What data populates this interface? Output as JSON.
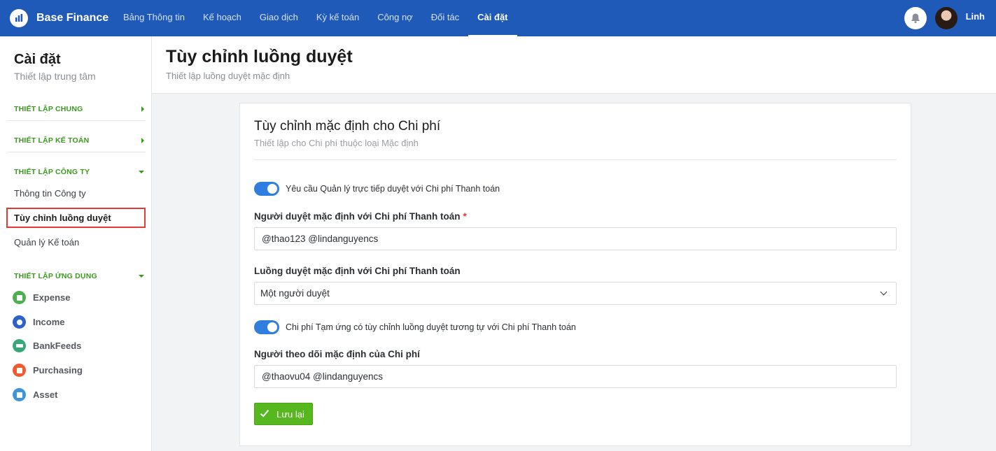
{
  "app": {
    "name": "Base Finance"
  },
  "nav": {
    "items": [
      {
        "label": "Bảng Thông tin"
      },
      {
        "label": "Kế hoạch"
      },
      {
        "label": "Giao dịch"
      },
      {
        "label": "Kỳ kế toán"
      },
      {
        "label": "Công nợ"
      },
      {
        "label": "Đối tác"
      },
      {
        "label": "Cài đặt",
        "active": true
      }
    ]
  },
  "user": {
    "name": "Linh"
  },
  "sidebar": {
    "title": "Cài đặt",
    "subtitle": "Thiết lập trung tâm",
    "sections": [
      {
        "label": "THIẾT LẬP CHUNG",
        "expanded": false
      },
      {
        "label": "THIẾT LẬP KẾ TOÁN",
        "expanded": false
      },
      {
        "label": "THIẾT LẬP CÔNG TY",
        "expanded": true
      },
      {
        "label": "THIẾT LẬP ỨNG DỤNG",
        "expanded": true
      }
    ],
    "company_links": [
      {
        "label": "Thông tin Công ty"
      },
      {
        "label": "Tùy chỉnh luồng duyệt",
        "active": true
      },
      {
        "label": "Quản lý Kế toán"
      }
    ],
    "apps": [
      {
        "label": "Expense",
        "icon": "expense-icon",
        "color": "#4caf50"
      },
      {
        "label": "Income",
        "icon": "income-icon",
        "color": "#2f5fc9"
      },
      {
        "label": "BankFeeds",
        "icon": "bankfeeds-icon",
        "color": "#3aa77a"
      },
      {
        "label": "Purchasing",
        "icon": "purchasing-icon",
        "color": "#ef5a2f"
      },
      {
        "label": "Asset",
        "icon": "asset-icon",
        "color": "#3f95d8"
      }
    ]
  },
  "page": {
    "title": "Tùy chỉnh luồng duyệt",
    "subtitle": "Thiết lập luồng duyệt mặc định"
  },
  "card": {
    "title": "Tùy chỉnh mặc định cho Chi phí",
    "subtitle": "Thiết lập cho Chi phí thuộc loại Mặc định",
    "toggle1_label": "Yêu cầu Quản lý trực tiếp duyệt với Chi phí Thanh toán",
    "toggle1_on": true,
    "approver_label": "Người duyệt mặc định với Chi phí Thanh toán",
    "approver_required": "*",
    "approver_value": "@thao123 @lindanguyencs",
    "flow_label": "Luồng duyệt mặc định với Chi phí Thanh toán",
    "flow_value": "Một người duyệt",
    "toggle2_label": "Chi phí Tạm ứng có tùy chỉnh luồng duyệt tương tự với Chi phí Thanh toán",
    "toggle2_on": true,
    "follower_label": "Người theo dõi mặc định của Chi phí",
    "follower_value": "@thaovu04 @lindanguyencs",
    "save_label": "Lưu lại"
  },
  "colors": {
    "topbar": "#1f5ab8",
    "accent_green": "#3a9a1e",
    "toggle_blue": "#2f7ee0",
    "save_green": "#56b81e",
    "highlight_red": "#e03a3a"
  }
}
